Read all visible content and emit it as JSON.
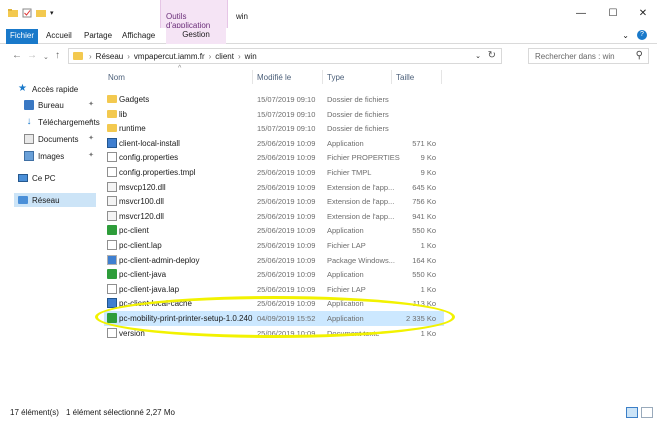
{
  "title_bar": {
    "context_tab": "Outils d'application",
    "window_title": "win",
    "minimize": "—",
    "maximize": "☐",
    "close": "✕"
  },
  "ribbon": {
    "tabs": [
      "Fichier",
      "Accueil",
      "Partage",
      "Affichage",
      "Gestion"
    ],
    "expand": "⌄",
    "help": "?"
  },
  "address": {
    "crumbs": [
      "Réseau",
      "vmpapercut.iamm.fr",
      "client",
      "win"
    ],
    "search_placeholder": "Rechercher dans : win"
  },
  "nav_pane": {
    "items": [
      {
        "label": "Accès rapide",
        "icon": "star-icon"
      },
      {
        "label": "Bureau",
        "icon": "desktop-icon",
        "pinned": true
      },
      {
        "label": "Téléchargements",
        "icon": "download-icon",
        "pinned": true
      },
      {
        "label": "Documents",
        "icon": "documents-icon",
        "pinned": true
      },
      {
        "label": "Images",
        "icon": "images-icon",
        "pinned": true
      },
      {
        "label": "Ce PC",
        "icon": "computer-icon"
      },
      {
        "label": "Réseau",
        "icon": "network-icon",
        "selected": true
      }
    ]
  },
  "columns": {
    "name": "Nom",
    "modified": "Modifié le",
    "type": "Type",
    "size": "Taille"
  },
  "files": [
    {
      "name": "Gadgets",
      "modified": "15/07/2019 09:10",
      "type": "Dossier de fichiers",
      "size": "",
      "icon": "folder-icon"
    },
    {
      "name": "lib",
      "modified": "15/07/2019 09:10",
      "type": "Dossier de fichiers",
      "size": "",
      "icon": "folder-icon"
    },
    {
      "name": "runtime",
      "modified": "15/07/2019 09:10",
      "type": "Dossier de fichiers",
      "size": "",
      "icon": "folder-icon"
    },
    {
      "name": "client-local-install",
      "modified": "25/06/2019 10:09",
      "type": "Application",
      "size": "571 Ko",
      "icon": "application-icon"
    },
    {
      "name": "config.properties",
      "modified": "25/06/2019 10:09",
      "type": "Fichier PROPERTIES",
      "size": "9 Ko",
      "icon": "file-icon"
    },
    {
      "name": "config.properties.tmpl",
      "modified": "25/06/2019 10:09",
      "type": "Fichier TMPL",
      "size": "9 Ko",
      "icon": "file-icon"
    },
    {
      "name": "msvcp120.dll",
      "modified": "25/06/2019 10:09",
      "type": "Extension de l'app...",
      "size": "645 Ko",
      "icon": "dll-icon"
    },
    {
      "name": "msvcr100.dll",
      "modified": "25/06/2019 10:09",
      "type": "Extension de l'app...",
      "size": "756 Ko",
      "icon": "dll-icon"
    },
    {
      "name": "msvcr120.dll",
      "modified": "25/06/2019 10:09",
      "type": "Extension de l'app...",
      "size": "941 Ko",
      "icon": "dll-icon"
    },
    {
      "name": "pc-client",
      "modified": "25/06/2019 10:09",
      "type": "Application",
      "size": "550 Ko",
      "icon": "papercut-icon"
    },
    {
      "name": "pc-client.lap",
      "modified": "25/06/2019 10:09",
      "type": "Fichier LAP",
      "size": "1 Ko",
      "icon": "file-icon"
    },
    {
      "name": "pc-client-admin-deploy",
      "modified": "25/06/2019 10:09",
      "type": "Package Windows...",
      "size": "164 Ko",
      "icon": "msi-icon"
    },
    {
      "name": "pc-client-java",
      "modified": "25/06/2019 10:09",
      "type": "Application",
      "size": "550 Ko",
      "icon": "papercut-icon"
    },
    {
      "name": "pc-client-java.lap",
      "modified": "25/06/2019 10:09",
      "type": "Fichier LAP",
      "size": "1 Ko",
      "icon": "file-icon"
    },
    {
      "name": "pc-client-local-cache",
      "modified": "25/06/2019 10:09",
      "type": "Application",
      "size": "113 Ko",
      "icon": "application-icon"
    },
    {
      "name": "pc-mobility-print-printer-setup-1.0.240",
      "modified": "04/09/2019 15:52",
      "type": "Application",
      "size": "2 335 Ko",
      "icon": "papercut-icon",
      "selected": true
    },
    {
      "name": "version",
      "modified": "25/06/2019 10:09",
      "type": "Document texte",
      "size": "1 Ko",
      "icon": "text-icon"
    }
  ],
  "status": {
    "count": "17 élément(s)",
    "selection": "1 élément sélectionné  2,27 Mo"
  },
  "colors": {
    "accent": "#1979ca",
    "selection": "#cce8ff",
    "highlight": "#f2f200"
  }
}
